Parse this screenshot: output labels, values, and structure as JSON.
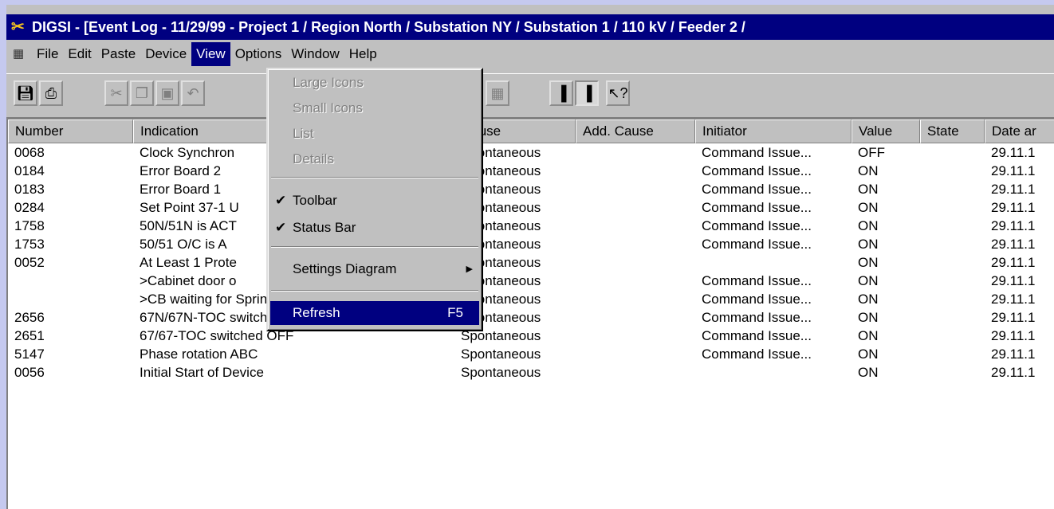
{
  "window": {
    "title": "DIGSI - [Event Log - 11/29/99 - Project 1 / Region North / Substation NY / Substation 1 / 110 kV / Feeder 2 /"
  },
  "menubar": {
    "items": [
      {
        "label": "File",
        "active": false
      },
      {
        "label": "Edit",
        "active": false
      },
      {
        "label": "Paste",
        "active": false
      },
      {
        "label": "Device",
        "active": false
      },
      {
        "label": "View",
        "active": true
      },
      {
        "label": "Options",
        "active": false
      },
      {
        "label": "Window",
        "active": false
      },
      {
        "label": "Help",
        "active": false
      }
    ]
  },
  "toolbar": {
    "icons": [
      "save-icon",
      "print-icon",
      "cut-icon",
      "copy-icon",
      "paste-icon",
      "undo-icon",
      "details-view-icon",
      "device-icon",
      "device-pressed-icon",
      "help-pointer-icon"
    ]
  },
  "view_menu": {
    "items": [
      {
        "label": "Large Icons",
        "disabled": true
      },
      {
        "label": "Small Icons",
        "disabled": true
      },
      {
        "label": "List",
        "disabled": true
      },
      {
        "label": "Details",
        "disabled": true
      },
      {
        "label": "Toolbar",
        "checked": true
      },
      {
        "label": "Status Bar",
        "checked": true
      },
      {
        "label": "Settings Diagram",
        "submenu": true
      },
      {
        "label": "Refresh",
        "shortcut": "F5",
        "highlighted": true
      }
    ]
  },
  "table": {
    "columns": [
      "Number",
      "Indication",
      "Cause",
      "Add. Cause",
      "Initiator",
      "Value",
      "State",
      "Date ar"
    ],
    "rows": [
      [
        "0068",
        "Clock Synchron",
        "Spontaneous",
        "",
        "Command Issue...",
        "OFF",
        "",
        "29.11.1"
      ],
      [
        "0184",
        "Error Board 2",
        "Spontaneous",
        "",
        "Command Issue...",
        "ON",
        "",
        "29.11.1"
      ],
      [
        "0183",
        "Error Board 1",
        "Spontaneous",
        "",
        "Command Issue...",
        "ON",
        "",
        "29.11.1"
      ],
      [
        "0284",
        "Set Point 37-1 U",
        "Spontaneous",
        "",
        "Command Issue...",
        "ON",
        "",
        "29.11.1"
      ],
      [
        "1758",
        "50N/51N is ACT",
        "Spontaneous",
        "",
        "Command Issue...",
        "ON",
        "",
        "29.11.1"
      ],
      [
        "1753",
        "50/51 O/C is A",
        "Spontaneous",
        "",
        "Command Issue...",
        "ON",
        "",
        "29.11.1"
      ],
      [
        "0052",
        "At Least 1 Prote",
        "Spontaneous",
        "",
        "",
        "ON",
        "",
        "29.11.1"
      ],
      [
        "",
        ">Cabinet door o",
        "Spontaneous",
        "",
        "Command Issue...",
        "ON",
        "",
        "29.11.1"
      ],
      [
        "",
        ">CB waiting for Spring charged",
        "Spontaneous",
        "",
        "Command Issue...",
        "ON",
        "",
        "29.11.1"
      ],
      [
        "2656",
        "67N/67N-TOC  switched OFF",
        "Spontaneous",
        "",
        "Command Issue...",
        "ON",
        "",
        "29.11.1"
      ],
      [
        "2651",
        "67/67-TOC switched OFF",
        "Spontaneous",
        "",
        "Command Issue...",
        "ON",
        "",
        "29.11.1"
      ],
      [
        "5147",
        "Phase rotation ABC",
        "Spontaneous",
        "",
        "Command Issue...",
        "ON",
        "",
        "29.11.1"
      ],
      [
        "0056",
        "Initial Start of Device",
        "Spontaneous",
        "",
        "",
        "ON",
        "",
        "29.11.1"
      ]
    ]
  }
}
